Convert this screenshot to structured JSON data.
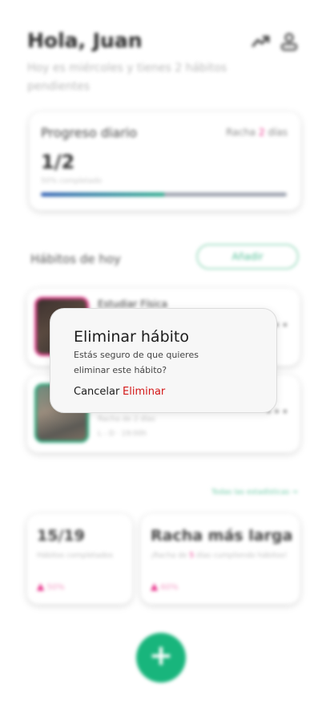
{
  "header": {
    "greeting": "Hola, Juan",
    "subtitle": "Hoy es miércoles y tienes 2 hábitos pendientes",
    "stats_icon": "trending-up-icon",
    "profile_icon": "user-icon"
  },
  "progress": {
    "title": "Progreso diario",
    "streak_prefix": "Racha ",
    "streak_value": "2",
    "streak_suffix": " días",
    "count": "1/2",
    "percent_label": "50% completado",
    "fraction": 0.5
  },
  "habits_section": {
    "title": "Hábitos de hoy",
    "add_label": "Añadir"
  },
  "habits": [
    {
      "name": "Estudiar Física",
      "thumb_color": "#e0408c"
    },
    {
      "streak": "Racha de 2 días",
      "schedule": "L - D · 19:00h",
      "thumb_color": "#2fa97c"
    }
  ],
  "stats": {
    "link": "Todas las estadísticas →",
    "completed": {
      "value": "15/19",
      "desc": "Hábitos completados",
      "trend": "50%"
    },
    "longest": {
      "title": "Racha más larga",
      "desc_prefix": "¡Racha de ",
      "desc_value": "5",
      "desc_suffix": " días cumpliendo hábitos!",
      "trend": "60%"
    }
  },
  "fab": {
    "icon": "plus-icon",
    "label": "+"
  },
  "dialog": {
    "title": "Eliminar hábito",
    "body": "Estás seguro de que quieres eliminar este hábito?",
    "cancel": "Cancelar",
    "confirm": "Eliminar"
  },
  "colors": {
    "accent_green": "#18b57c",
    "accent_pink": "#e8318a",
    "danger": "#d31717"
  }
}
